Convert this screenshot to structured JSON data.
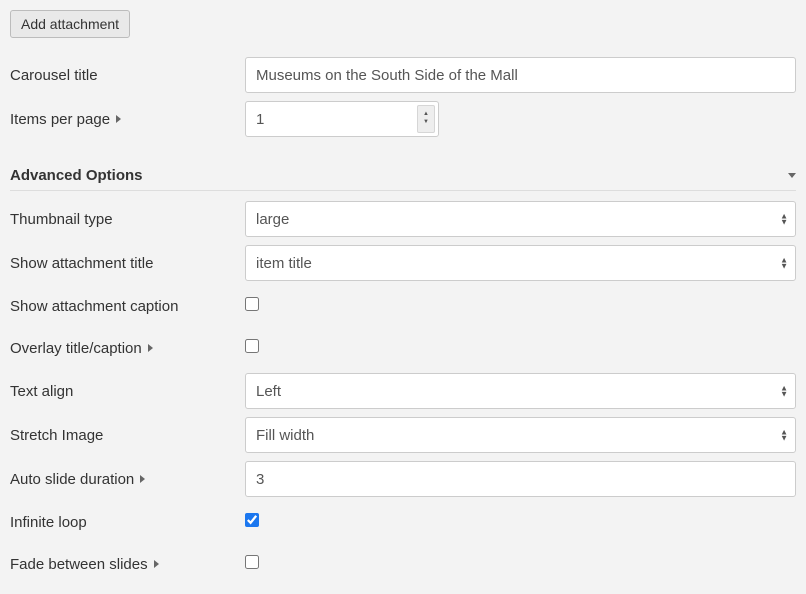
{
  "add_attachment_label": "Add attachment",
  "carousel_title": {
    "label": "Carousel title",
    "value": "Museums on the South Side of the Mall"
  },
  "items_per_page": {
    "label": "Items per page",
    "value": "1"
  },
  "advanced_options_label": "Advanced Options",
  "thumbnail_type": {
    "label": "Thumbnail type",
    "value": "large"
  },
  "show_attachment_title": {
    "label": "Show attachment title",
    "value": "item title"
  },
  "show_attachment_caption": {
    "label": "Show attachment caption",
    "checked": false
  },
  "overlay_title_caption": {
    "label": "Overlay title/caption",
    "checked": false
  },
  "text_align": {
    "label": "Text align",
    "value": "Left"
  },
  "stretch_image": {
    "label": "Stretch Image",
    "value": "Fill width"
  },
  "auto_slide_duration": {
    "label": "Auto slide duration",
    "value": "3"
  },
  "infinite_loop": {
    "label": "Infinite loop",
    "checked": true
  },
  "fade_between_slides": {
    "label": "Fade between slides",
    "checked": false
  }
}
